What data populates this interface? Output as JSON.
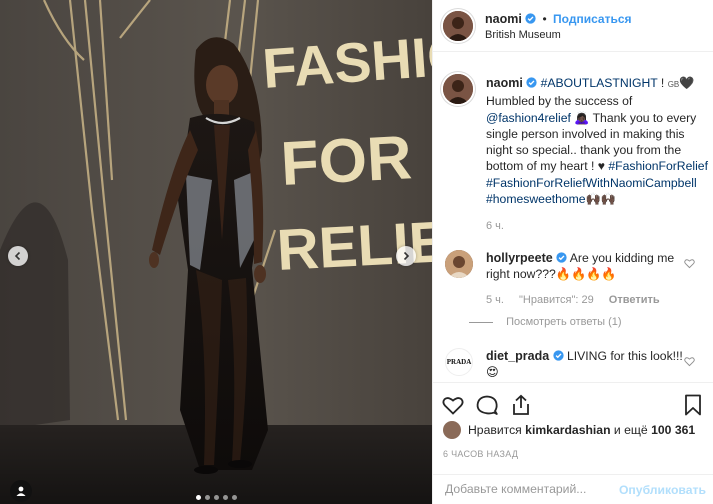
{
  "colors": {
    "accent": "#3897f0",
    "hashtag": "#003569",
    "muted": "#999999",
    "border": "#efefef"
  },
  "photo": {
    "backdrop_text": [
      "FASHIO",
      "FOR",
      "RELIE"
    ],
    "dots_total": 5,
    "dots_active": 1
  },
  "header": {
    "username": "naomi",
    "follow_label": "Подписаться",
    "separator": "•",
    "location": "British Museum"
  },
  "caption": {
    "username": "naomi",
    "parts": [
      {
        "text": "#ABOUTLASTNIGHT",
        "tag": true
      },
      {
        "text": " ! ",
        "tag": false
      },
      {
        "text": "GB",
        "tag": false,
        "small": true
      },
      {
        "text": "🖤",
        "tag": false
      },
      {
        "text": " Humbled by the success of ",
        "tag": false
      },
      {
        "text": "@fashion4relief",
        "tag": true
      },
      {
        "text": " 🙇🏿‍♀️ Thank you to every single person involved in making this night so special.. thank you from the bottom of my heart ! ♥ ",
        "tag": false
      },
      {
        "text": "#FashionForRelief",
        "tag": true
      },
      {
        "text": " ",
        "tag": false
      },
      {
        "text": "#FashionForReliefWithNaomiCampbell",
        "tag": true
      },
      {
        "text": " ",
        "tag": false
      },
      {
        "text": "#homesweethome",
        "tag": true
      },
      {
        "text": "🙌🏿🙌🏿",
        "tag": false
      }
    ],
    "time": "6 ч."
  },
  "comments": [
    {
      "username": "hollyrpeete",
      "verified": true,
      "text": "Are you kidding me right now???🔥🔥🔥🔥",
      "time": "5 ч.",
      "likes": "\"Нравится\": 29",
      "reply": "Ответить",
      "view_replies": "Посмотреть ответы (1)"
    },
    {
      "username": "diet_prada",
      "verified": true,
      "text": "LIVING for this look!!! 😍",
      "avatar_text": "PRADA"
    }
  ],
  "actions": {
    "like_icon": "heart-icon",
    "comment_icon": "comment-icon",
    "share_icon": "share-icon",
    "save_icon": "bookmark-icon"
  },
  "likes": {
    "prefix": "Нравится",
    "user": "kimkardashian",
    "middle": "и ещё",
    "count": "100 361"
  },
  "timestamp": "6 ЧАСОВ НАЗАД",
  "comment_input": {
    "placeholder": "Добавьте комментарий...",
    "publish_label": "Опубликовать"
  }
}
